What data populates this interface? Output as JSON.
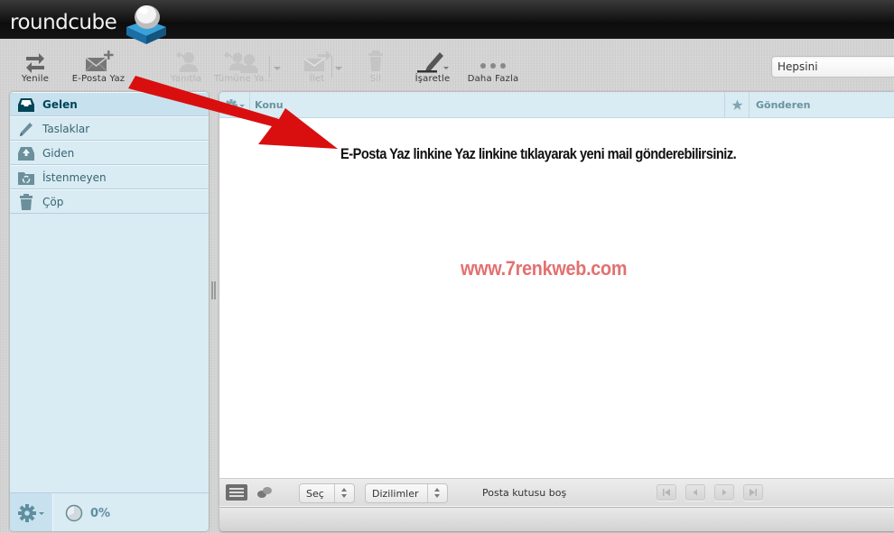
{
  "app": {
    "logo_text": "roundcube"
  },
  "toolbar": {
    "buttons": [
      {
        "id": "refresh",
        "label": "Yenile",
        "icon": "refresh-arrows-icon",
        "enabled": true
      },
      {
        "id": "compose",
        "label": "E-Posta Yaz",
        "icon": "compose-envelope-plus-icon",
        "enabled": true
      },
      {
        "id": "reply",
        "label": "Yanıtla",
        "icon": "reply-person-icon",
        "enabled": false
      },
      {
        "id": "reply-all",
        "label": "Tümüne Ya...",
        "icon": "reply-all-people-icon",
        "enabled": false
      },
      {
        "id": "forward",
        "label": "İlet",
        "icon": "forward-envelope-icon",
        "enabled": false
      },
      {
        "id": "delete",
        "label": "Sil",
        "icon": "trash-icon",
        "enabled": false
      },
      {
        "id": "mark",
        "label": "İşaretle",
        "icon": "marker-pen-icon",
        "enabled": true
      },
      {
        "id": "more",
        "label": "Daha Fazla",
        "icon": "more-dots-icon",
        "enabled": true
      }
    ],
    "search_filter": {
      "value": "Hepsini"
    }
  },
  "sidebar": {
    "folders": [
      {
        "label": "Gelen",
        "icon": "inbox-icon",
        "selected": true
      },
      {
        "label": "Taslaklar",
        "icon": "pencil-icon",
        "selected": false
      },
      {
        "label": "Giden",
        "icon": "outbox-icon",
        "selected": false
      },
      {
        "label": "İstenmeyen",
        "icon": "junk-recycle-icon",
        "selected": false
      },
      {
        "label": "Çöp",
        "icon": "trash-icon",
        "selected": false
      }
    ],
    "quota": {
      "text": "0%",
      "percent": 0
    }
  },
  "message_list": {
    "columns": {
      "subject": "Konu",
      "from": "Gönderen"
    },
    "footer": {
      "select_label": "Seç",
      "threads_label": "Dizilimler",
      "count_text": "Posta kutusu boş"
    }
  },
  "annotation": {
    "text": "E-Posta Yaz linkine Yaz linkine tıklayarak yeni mail gönderebilirsiniz.",
    "watermark": "www.7renkweb.com",
    "arrow_color": "#d90f0f",
    "watermark_color": "#e37070"
  }
}
